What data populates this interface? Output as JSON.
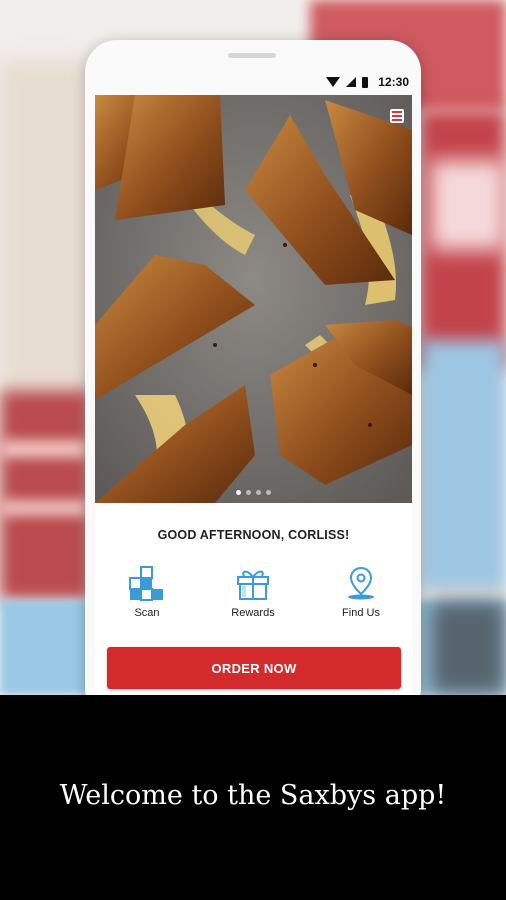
{
  "status_bar": {
    "time": "12:30"
  },
  "home": {
    "greeting": "GOOD AFTERNOON, CORLISS!",
    "carousel": {
      "total": 4,
      "active": 1
    },
    "actions": [
      {
        "label": "Scan",
        "icon": "scan-icon"
      },
      {
        "label": "Rewards",
        "icon": "gift-icon"
      },
      {
        "label": "Find Us",
        "icon": "location-pin-icon"
      }
    ],
    "order_button": "ORDER NOW"
  },
  "colors": {
    "accent": "#d32b2b",
    "icon_blue": "#3a9bd9"
  },
  "caption": "Welcome to the Saxbys app!"
}
